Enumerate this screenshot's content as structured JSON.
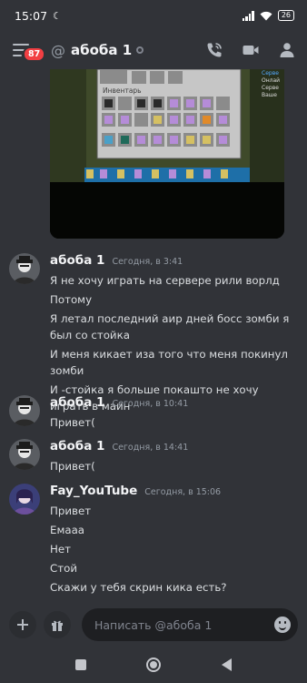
{
  "status_bar": {
    "time": "15:07",
    "battery": "26"
  },
  "header": {
    "notification_count": "87",
    "channel_name": "абоба 1"
  },
  "attachment": {
    "inventory_title": "Инвентарь",
    "side_text": [
      "Серве",
      "Онлай",
      "Серве",
      "Ваше"
    ]
  },
  "messages": [
    {
      "author": "абоба 1",
      "timestamp": "Сегодня, в 3:41",
      "lines": [
        "Я не хочу играть на сервере рили ворлд",
        "Потому",
        "Я летал последний аир дней босс зомби я был со стойка",
        "И меня кикает иза того что меня покинул зомби",
        "И -стойка я больше покашто не хочу играть в маин"
      ]
    },
    {
      "author": "абоба 1",
      "timestamp": "Сегодня, в 10:41",
      "lines": [
        "Привет("
      ]
    },
    {
      "author": "абоба 1",
      "timestamp": "Сегодня, в 14:41",
      "lines": [
        "Привет("
      ]
    },
    {
      "author": "Fay_YouTube",
      "timestamp": "Сегодня, в 15:06",
      "lines": [
        "Привет",
        "Емааа",
        "Нет",
        "Стой",
        "Скажи у тебя скрин кика есть?"
      ]
    }
  ],
  "composer": {
    "placeholder": "Написать @абоба 1"
  },
  "icons": {
    "menu": "hamburger-menu-icon",
    "at": "at-sign-icon",
    "call": "phone-call-icon",
    "video": "video-camera-icon",
    "members": "members-icon",
    "add": "plus-icon",
    "gift": "gift-icon",
    "emoji": "emoji-icon"
  },
  "colors": {
    "background": "#313338",
    "badge": "#f23f43",
    "input": "#1e1f22"
  }
}
